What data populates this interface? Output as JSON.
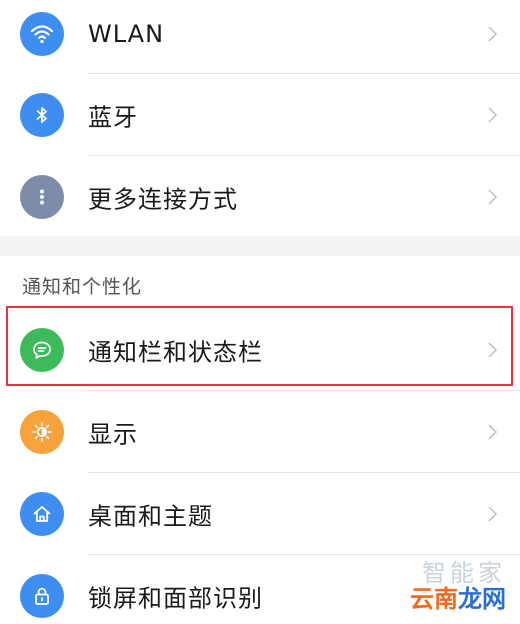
{
  "items": [
    {
      "label": "WLAN",
      "icon": "wifi-icon",
      "color": "#3d8ef0"
    },
    {
      "label": "蓝牙",
      "icon": "bluetooth-icon",
      "color": "#3d8ef0"
    },
    {
      "label": "更多连接方式",
      "icon": "more-dots-icon",
      "color": "#7d8ca8"
    }
  ],
  "section_title": "通知和个性化",
  "section_items": [
    {
      "label": "通知栏和状态栏",
      "icon": "message-bubble-icon",
      "color": "#3dbb5b"
    },
    {
      "label": "显示",
      "icon": "brightness-icon",
      "color": "#f7a23a"
    },
    {
      "label": "桌面和主题",
      "icon": "home-icon",
      "color": "#3d8ef0"
    },
    {
      "label": "锁屏和面部识别",
      "icon": "lock-icon",
      "color": "#3d8ef0"
    }
  ],
  "highlight_color": "#e2343a",
  "watermark": {
    "top": "智能家",
    "main_orange": "云南",
    "main_blue": "龙网"
  }
}
